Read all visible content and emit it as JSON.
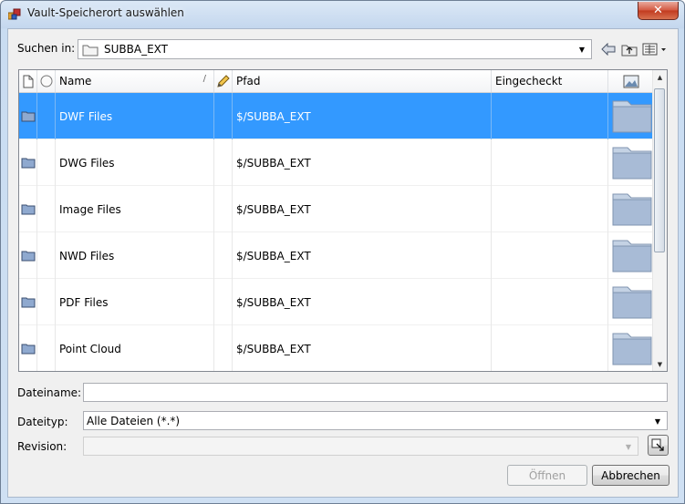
{
  "window": {
    "title": "Vault-Speicherort auswählen",
    "close_symbol": "✕"
  },
  "lookin": {
    "label": "Suchen in:",
    "value": "SUBBA_EXT"
  },
  "grid": {
    "columns": {
      "name": "Name",
      "sort_marker": "/",
      "path": "Pfad",
      "checkedin": "Eingecheckt"
    },
    "rows": [
      {
        "name": "DWF Files",
        "path": "$/SUBBA_EXT",
        "selected": true
      },
      {
        "name": "DWG Files",
        "path": "$/SUBBA_EXT",
        "selected": false
      },
      {
        "name": "Image Files",
        "path": "$/SUBBA_EXT",
        "selected": false
      },
      {
        "name": "NWD Files",
        "path": "$/SUBBA_EXT",
        "selected": false
      },
      {
        "name": "PDF Files",
        "path": "$/SUBBA_EXT",
        "selected": false
      },
      {
        "name": "Point Cloud",
        "path": "$/SUBBA_EXT",
        "selected": false
      }
    ]
  },
  "form": {
    "filename_label": "Dateiname:",
    "filename_value": "",
    "filetype_label": "Dateityp:",
    "filetype_value": "Alle Dateien (*.*)",
    "revision_label": "Revision:",
    "revision_value": ""
  },
  "buttons": {
    "open": "Öffnen",
    "cancel": "Abbrechen"
  },
  "icons": {
    "title": "vault-app-icon",
    "back": "back-arrow-icon",
    "up": "up-folder-icon",
    "views": "view-menu-icon",
    "folder": "folder-icon",
    "thumbnail": "folder-thumbnail-icon",
    "revision_browse": "revision-browse-icon"
  },
  "colors": {
    "selection": "#3399ff",
    "window_frame": "#c4d7ee"
  }
}
